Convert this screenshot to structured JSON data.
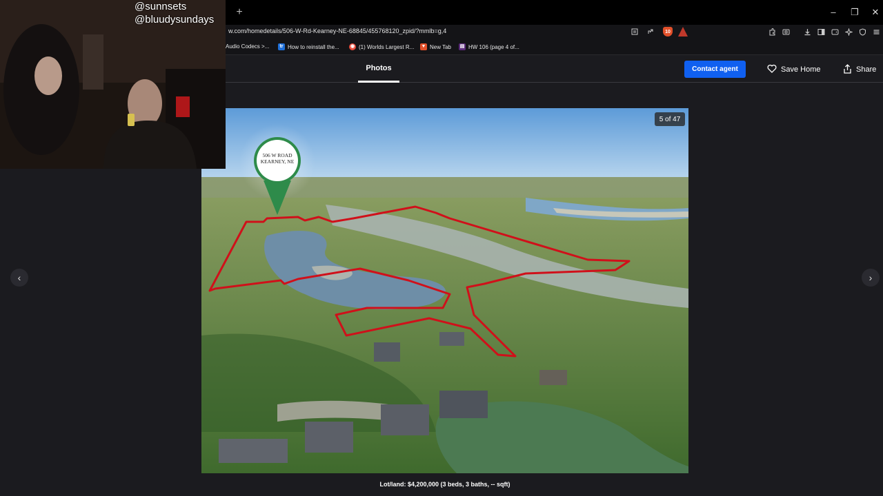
{
  "browser": {
    "url": "w.com/homedetails/506-W-Rd-Kearney-NE-68845/455768120_zpid/?mmlb=g,4",
    "new_tab_symbol": "+",
    "window_controls": [
      "–",
      "❐",
      "✕"
    ],
    "shield_count": "10",
    "bookmarks": [
      {
        "label": "Audio Codecs >..."
      },
      {
        "label": "How to reinstall the...",
        "fav": "tr",
        "color": "#1e6fd9"
      },
      {
        "label": "(1) Worlds Largest R...",
        "fav": "◉",
        "color": "#e74c3c"
      },
      {
        "label": "New Tab",
        "fav": "▼",
        "color": "#e2502a"
      },
      {
        "label": "HW 106 (page 4 of...",
        "fav": "▤",
        "color": "#5a2a7a"
      }
    ]
  },
  "header": {
    "tab_photos": "Photos",
    "contact_agent": "Contact agent",
    "save_home": "Save Home",
    "share": "Share"
  },
  "viewer": {
    "counter": "5 of 47",
    "pin_label_line1": "506 W ROAD",
    "pin_label_line2": "KEARNEY, NE",
    "caption": "Lot/land: $4,200,000 (3 beds, 3 baths, -- sqft)",
    "prev_symbol": "‹",
    "next_symbol": "›"
  },
  "overlay": {
    "handle1": "@sunnsets",
    "handle2": "@bluudysundays"
  },
  "colors": {
    "accent_blue": "#1060f0",
    "boundary_red": "#d0101a",
    "pin_green": "#2e8b4a"
  }
}
